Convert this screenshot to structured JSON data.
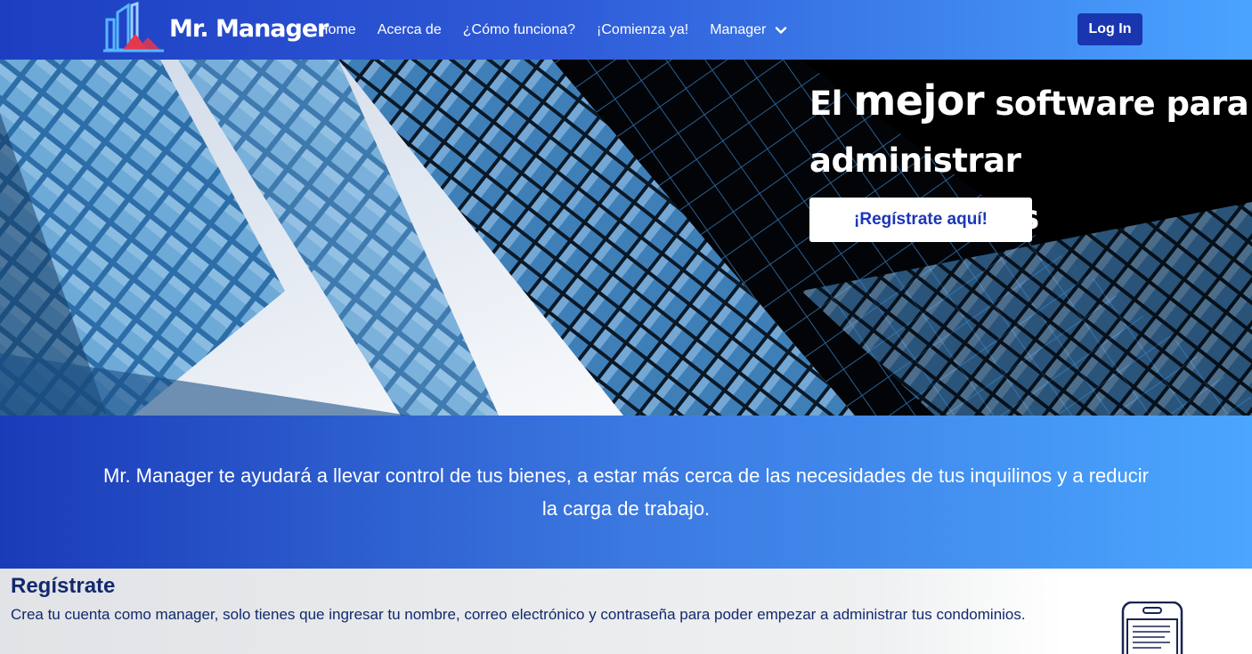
{
  "brand": {
    "name": "Mr. Manager"
  },
  "nav": {
    "items": [
      {
        "label": "Home"
      },
      {
        "label": "Acerca de"
      },
      {
        "label": "¿Cómo funciona?"
      },
      {
        "label": "¡Comienza ya!"
      }
    ],
    "dropdown_label": "Manager",
    "login_label": "Log In"
  },
  "hero": {
    "title_prefix": "El ",
    "title_emphasis": "mejor",
    "title_rest": " software para administrar condominios",
    "cta_label": "¡Regístrate aquí!"
  },
  "band": {
    "text": "Mr. Manager te ayudará a llevar control de tus bienes, a estar más cerca de las necesidades de tus inquilinos y a reducir la carga de trabajo."
  },
  "register": {
    "title": "Regístrate",
    "description": "Crea tu cuenta como manager, solo tienes que ingresar tu nombre, correo electrónico y contraseña para poder empezar a administrar tus condominios."
  },
  "colors": {
    "primary": "#1a35b0",
    "accent": "#4aa4ff",
    "text_dark": "#12296e",
    "logo_red": "#e5374f"
  },
  "icons": {
    "logo": "building-logo-icon",
    "dropdown": "chevron-down-icon",
    "phone": "smartphone-icon"
  }
}
